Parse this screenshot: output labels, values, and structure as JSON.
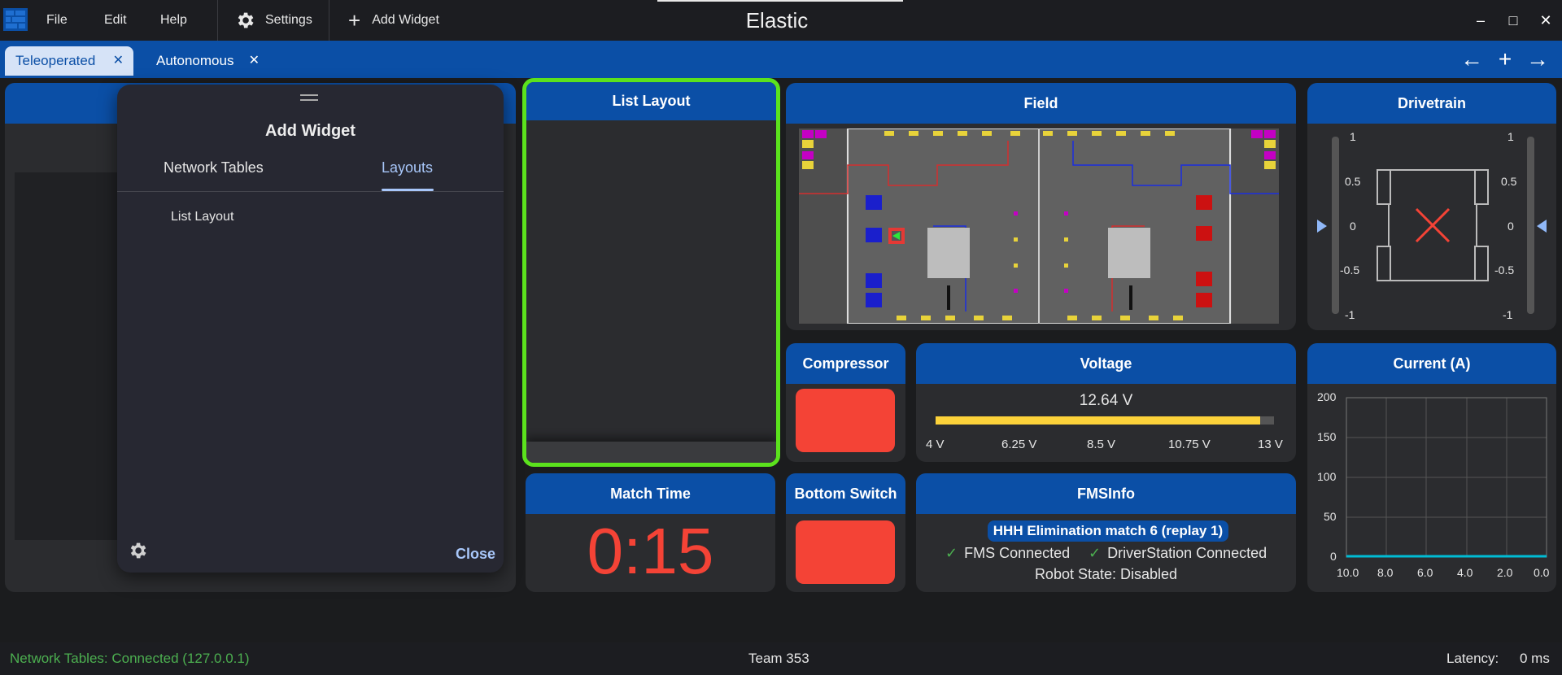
{
  "app": {
    "title": "Elastic"
  },
  "menu": {
    "file": "File",
    "edit": "Edit",
    "help": "Help",
    "settings": "Settings",
    "add_widget": "Add Widget"
  },
  "window_controls": {
    "minimize": "–",
    "maximize": "□",
    "close": "✕"
  },
  "tabs": [
    {
      "label": "Teleoperated",
      "close": "✕"
    },
    {
      "label": "Autonomous",
      "close": "✕"
    }
  ],
  "tab_nav": {
    "back": "←",
    "add": "+",
    "forward": "→"
  },
  "dialog": {
    "title": "Add Widget",
    "tabs": [
      "Network Tables",
      "Layouts"
    ],
    "items": [
      "List Layout"
    ],
    "close": "Close"
  },
  "widgets": {
    "list_layout": {
      "title": "List Layout"
    },
    "field": {
      "title": "Field"
    },
    "drivetrain": {
      "title": "Drivetrain",
      "ticks": [
        "1",
        "0.5",
        "0",
        "-0.5",
        "-1"
      ]
    },
    "compressor": {
      "title": "Compressor",
      "state_color": "#f44336"
    },
    "voltage": {
      "title": "Voltage",
      "value": "12.64 V",
      "fraction": 0.96,
      "ticks": [
        "4 V",
        "6.25 V",
        "8.5 V",
        "10.75 V",
        "13 V"
      ]
    },
    "current": {
      "title": "Current (A)",
      "y_ticks": [
        "200",
        "150",
        "100",
        "50",
        "0"
      ],
      "x_ticks": [
        "10.0",
        "8.0",
        "6.0",
        "4.0",
        "2.0",
        "0.0"
      ],
      "line_color": "#00bcd4"
    },
    "match_time": {
      "title": "Match Time",
      "value": "0:15",
      "color": "#f44336"
    },
    "bottom_switch": {
      "title": "Bottom Switch",
      "state_color": "#f44336"
    },
    "fms_info": {
      "title": "FMSInfo",
      "match": "HHH Elimination match 6 (replay 1)",
      "fms_connected": "FMS Connected",
      "ds_connected": "DriverStation Connected",
      "robot_state": "Robot State: Disabled"
    }
  },
  "status": {
    "connection": "Network Tables: Connected (127.0.0.1)",
    "team": "Team 353",
    "latency_label": "Latency:",
    "latency_value": "0 ms"
  },
  "colors": {
    "accent": "#0b4fa6",
    "highlight": "#5be21d",
    "connected": "#4caf50",
    "alert": "#f44336"
  }
}
